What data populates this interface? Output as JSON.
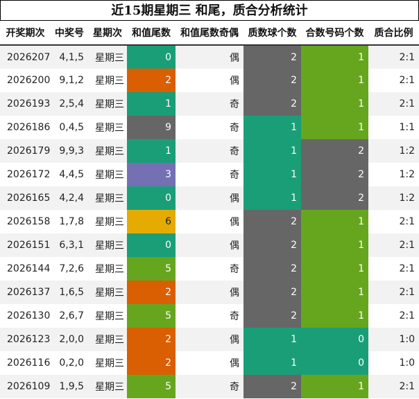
{
  "title": "近15期星期三 和尾，质合分析统计",
  "headers": [
    "开奖期次",
    "中奖号",
    "星期次",
    "和值尾数",
    "和值尾数奇偶",
    "质数球个数",
    "合数号码个数",
    "质合比例"
  ],
  "colors": {
    "tail": {
      "0": "#1a9e77",
      "1": "#1a9e77",
      "2": "#d95f02",
      "3": "#7570b3",
      "5": "#66a61e",
      "6": "#e6ab02",
      "9": "#666666"
    },
    "count": {
      "0": "#1a9e77",
      "1": "#1a9e77",
      "2": "#666666"
    },
    "count_alt": {
      "0": "#1a9e77",
      "1": "#66a61e",
      "2": "#666666"
    }
  },
  "rows": [
    {
      "issue": "2026207",
      "nums": "4,1,5",
      "week": "星期三",
      "tail": "0",
      "oe": "偶",
      "prime": "2",
      "comp": "1",
      "ratio": "2:1"
    },
    {
      "issue": "2026200",
      "nums": "9,1,2",
      "week": "星期三",
      "tail": "2",
      "oe": "偶",
      "prime": "2",
      "comp": "1",
      "ratio": "2:1"
    },
    {
      "issue": "2026193",
      "nums": "2,5,4",
      "week": "星期三",
      "tail": "1",
      "oe": "奇",
      "prime": "2",
      "comp": "1",
      "ratio": "2:1"
    },
    {
      "issue": "2026186",
      "nums": "0,4,5",
      "week": "星期三",
      "tail": "9",
      "oe": "奇",
      "prime": "1",
      "comp": "1",
      "ratio": "1:1"
    },
    {
      "issue": "2026179",
      "nums": "9,9,3",
      "week": "星期三",
      "tail": "1",
      "oe": "奇",
      "prime": "1",
      "comp": "2",
      "ratio": "1:2"
    },
    {
      "issue": "2026172",
      "nums": "4,4,5",
      "week": "星期三",
      "tail": "3",
      "oe": "奇",
      "prime": "1",
      "comp": "2",
      "ratio": "1:2"
    },
    {
      "issue": "2026165",
      "nums": "4,2,4",
      "week": "星期三",
      "tail": "0",
      "oe": "偶",
      "prime": "1",
      "comp": "2",
      "ratio": "1:2"
    },
    {
      "issue": "2026158",
      "nums": "1,7,8",
      "week": "星期三",
      "tail": "6",
      "oe": "偶",
      "prime": "2",
      "comp": "1",
      "ratio": "2:1"
    },
    {
      "issue": "2026151",
      "nums": "6,3,1",
      "week": "星期三",
      "tail": "0",
      "oe": "偶",
      "prime": "2",
      "comp": "1",
      "ratio": "2:1"
    },
    {
      "issue": "2026144",
      "nums": "7,2,6",
      "week": "星期三",
      "tail": "5",
      "oe": "奇",
      "prime": "2",
      "comp": "1",
      "ratio": "2:1"
    },
    {
      "issue": "2026137",
      "nums": "1,6,5",
      "week": "星期三",
      "tail": "2",
      "oe": "偶",
      "prime": "2",
      "comp": "1",
      "ratio": "2:1"
    },
    {
      "issue": "2026130",
      "nums": "2,6,7",
      "week": "星期三",
      "tail": "5",
      "oe": "奇",
      "prime": "2",
      "comp": "1",
      "ratio": "2:1"
    },
    {
      "issue": "2026123",
      "nums": "2,0,0",
      "week": "星期三",
      "tail": "2",
      "oe": "偶",
      "prime": "1",
      "comp": "0",
      "ratio": "1:0"
    },
    {
      "issue": "2026116",
      "nums": "0,2,0",
      "week": "星期三",
      "tail": "2",
      "oe": "偶",
      "prime": "1",
      "comp": "0",
      "ratio": "1:0"
    },
    {
      "issue": "2026109",
      "nums": "1,9,5",
      "week": "星期三",
      "tail": "5",
      "oe": "奇",
      "prime": "2",
      "comp": "1",
      "ratio": "2:1"
    }
  ]
}
